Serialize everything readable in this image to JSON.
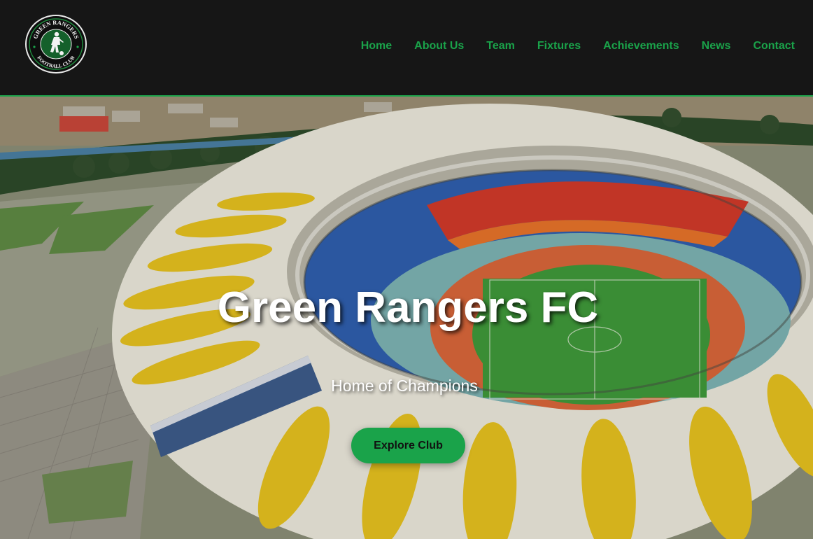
{
  "header": {
    "logo": {
      "top_text": "GREEN RANGERS",
      "bottom_text": "FOOTBALL CLUB",
      "icon": "footballer-crest-icon"
    },
    "nav": [
      {
        "label": "Home"
      },
      {
        "label": "About Us"
      },
      {
        "label": "Team"
      },
      {
        "label": "Fixtures"
      },
      {
        "label": "Achievements"
      },
      {
        "label": "News"
      },
      {
        "label": "Contact"
      }
    ]
  },
  "hero": {
    "title": "Green Rangers FC",
    "subtitle": "Home of Champions",
    "cta_label": "Explore Club",
    "background": "aerial-stadium-photo"
  },
  "colors": {
    "brand_green": "#1aa34a",
    "header_bg": "#161616",
    "text_white": "#ffffff"
  }
}
